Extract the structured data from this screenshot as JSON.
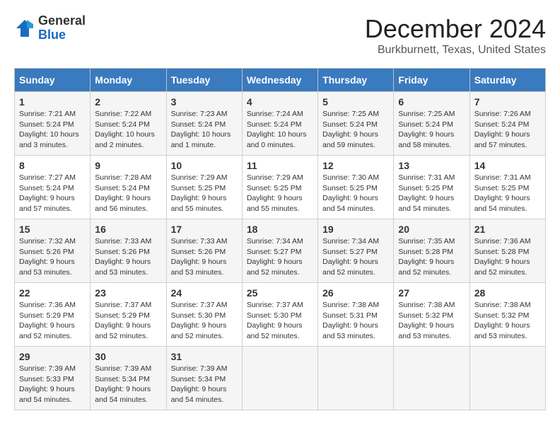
{
  "header": {
    "logo_general": "General",
    "logo_blue": "Blue",
    "month_title": "December 2024",
    "location": "Burkburnett, Texas, United States"
  },
  "days_of_week": [
    "Sunday",
    "Monday",
    "Tuesday",
    "Wednesday",
    "Thursday",
    "Friday",
    "Saturday"
  ],
  "weeks": [
    [
      {
        "day": "1",
        "sunrise": "7:21 AM",
        "sunset": "5:24 PM",
        "daylight": "10 hours and 3 minutes."
      },
      {
        "day": "2",
        "sunrise": "7:22 AM",
        "sunset": "5:24 PM",
        "daylight": "10 hours and 2 minutes."
      },
      {
        "day": "3",
        "sunrise": "7:23 AM",
        "sunset": "5:24 PM",
        "daylight": "10 hours and 1 minute."
      },
      {
        "day": "4",
        "sunrise": "7:24 AM",
        "sunset": "5:24 PM",
        "daylight": "10 hours and 0 minutes."
      },
      {
        "day": "5",
        "sunrise": "7:25 AM",
        "sunset": "5:24 PM",
        "daylight": "9 hours and 59 minutes."
      },
      {
        "day": "6",
        "sunrise": "7:25 AM",
        "sunset": "5:24 PM",
        "daylight": "9 hours and 58 minutes."
      },
      {
        "day": "7",
        "sunrise": "7:26 AM",
        "sunset": "5:24 PM",
        "daylight": "9 hours and 57 minutes."
      }
    ],
    [
      {
        "day": "8",
        "sunrise": "7:27 AM",
        "sunset": "5:24 PM",
        "daylight": "9 hours and 57 minutes."
      },
      {
        "day": "9",
        "sunrise": "7:28 AM",
        "sunset": "5:24 PM",
        "daylight": "9 hours and 56 minutes."
      },
      {
        "day": "10",
        "sunrise": "7:29 AM",
        "sunset": "5:25 PM",
        "daylight": "9 hours and 55 minutes."
      },
      {
        "day": "11",
        "sunrise": "7:29 AM",
        "sunset": "5:25 PM",
        "daylight": "9 hours and 55 minutes."
      },
      {
        "day": "12",
        "sunrise": "7:30 AM",
        "sunset": "5:25 PM",
        "daylight": "9 hours and 54 minutes."
      },
      {
        "day": "13",
        "sunrise": "7:31 AM",
        "sunset": "5:25 PM",
        "daylight": "9 hours and 54 minutes."
      },
      {
        "day": "14",
        "sunrise": "7:31 AM",
        "sunset": "5:25 PM",
        "daylight": "9 hours and 54 minutes."
      }
    ],
    [
      {
        "day": "15",
        "sunrise": "7:32 AM",
        "sunset": "5:26 PM",
        "daylight": "9 hours and 53 minutes."
      },
      {
        "day": "16",
        "sunrise": "7:33 AM",
        "sunset": "5:26 PM",
        "daylight": "9 hours and 53 minutes."
      },
      {
        "day": "17",
        "sunrise": "7:33 AM",
        "sunset": "5:26 PM",
        "daylight": "9 hours and 53 minutes."
      },
      {
        "day": "18",
        "sunrise": "7:34 AM",
        "sunset": "5:27 PM",
        "daylight": "9 hours and 52 minutes."
      },
      {
        "day": "19",
        "sunrise": "7:34 AM",
        "sunset": "5:27 PM",
        "daylight": "9 hours and 52 minutes."
      },
      {
        "day": "20",
        "sunrise": "7:35 AM",
        "sunset": "5:28 PM",
        "daylight": "9 hours and 52 minutes."
      },
      {
        "day": "21",
        "sunrise": "7:36 AM",
        "sunset": "5:28 PM",
        "daylight": "9 hours and 52 minutes."
      }
    ],
    [
      {
        "day": "22",
        "sunrise": "7:36 AM",
        "sunset": "5:29 PM",
        "daylight": "9 hours and 52 minutes."
      },
      {
        "day": "23",
        "sunrise": "7:37 AM",
        "sunset": "5:29 PM",
        "daylight": "9 hours and 52 minutes."
      },
      {
        "day": "24",
        "sunrise": "7:37 AM",
        "sunset": "5:30 PM",
        "daylight": "9 hours and 52 minutes."
      },
      {
        "day": "25",
        "sunrise": "7:37 AM",
        "sunset": "5:30 PM",
        "daylight": "9 hours and 52 minutes."
      },
      {
        "day": "26",
        "sunrise": "7:38 AM",
        "sunset": "5:31 PM",
        "daylight": "9 hours and 53 minutes."
      },
      {
        "day": "27",
        "sunrise": "7:38 AM",
        "sunset": "5:32 PM",
        "daylight": "9 hours and 53 minutes."
      },
      {
        "day": "28",
        "sunrise": "7:38 AM",
        "sunset": "5:32 PM",
        "daylight": "9 hours and 53 minutes."
      }
    ],
    [
      {
        "day": "29",
        "sunrise": "7:39 AM",
        "sunset": "5:33 PM",
        "daylight": "9 hours and 54 minutes."
      },
      {
        "day": "30",
        "sunrise": "7:39 AM",
        "sunset": "5:34 PM",
        "daylight": "9 hours and 54 minutes."
      },
      {
        "day": "31",
        "sunrise": "7:39 AM",
        "sunset": "5:34 PM",
        "daylight": "9 hours and 54 minutes."
      },
      null,
      null,
      null,
      null
    ]
  ]
}
